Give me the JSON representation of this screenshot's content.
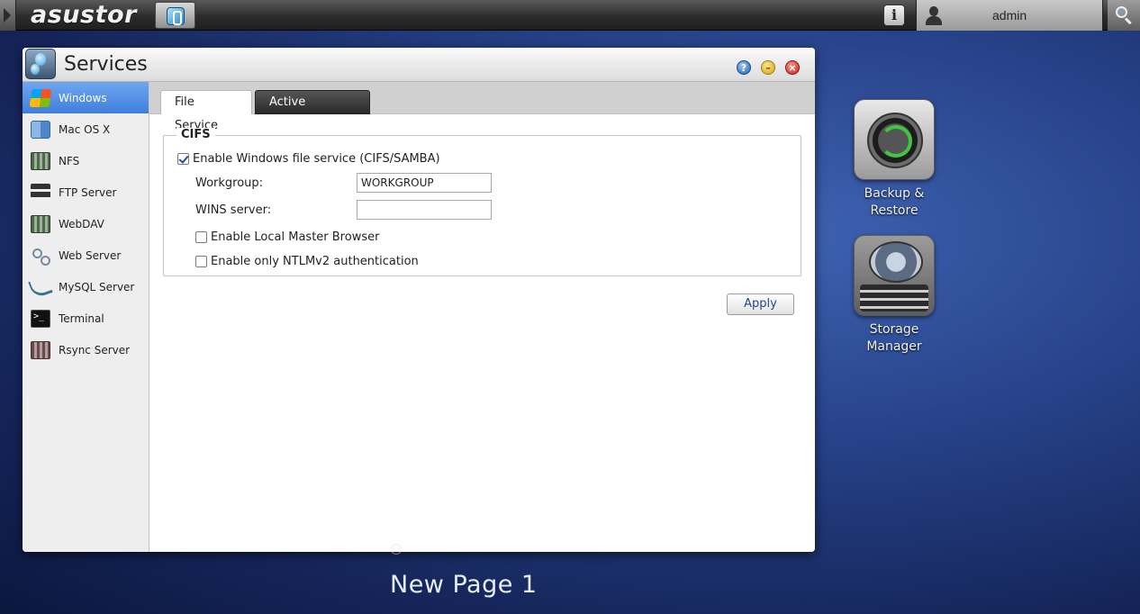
{
  "topbar": {
    "brand": "asustor",
    "username": "admin"
  },
  "window": {
    "title": "Services"
  },
  "sidebar": {
    "items": [
      {
        "label": "Windows",
        "icon": "windows-icon",
        "active": true
      },
      {
        "label": "Mac OS X",
        "icon": "mac-icon",
        "active": false
      },
      {
        "label": "NFS",
        "icon": "nfs-icon",
        "active": false
      },
      {
        "label": "FTP Server",
        "icon": "ftp-icon",
        "active": false
      },
      {
        "label": "WebDAV",
        "icon": "webdav-icon",
        "active": false
      },
      {
        "label": "Web Server",
        "icon": "web-server-icon",
        "active": false
      },
      {
        "label": "MySQL Server",
        "icon": "mysql-icon",
        "active": false
      },
      {
        "label": "Terminal",
        "icon": "terminal-icon",
        "active": false
      },
      {
        "label": "Rsync Server",
        "icon": "rsync-icon",
        "active": false
      }
    ]
  },
  "tabs": [
    {
      "label": "File Service",
      "active": true
    },
    {
      "label": "Active Directory",
      "active": false
    }
  ],
  "cifs": {
    "legend": "CIFS",
    "enable_label": "Enable Windows file service (CIFS/SAMBA)",
    "enable_checked": true,
    "workgroup_label": "Workgroup:",
    "workgroup_value": "WORKGROUP",
    "wins_label": "WINS server:",
    "wins_value": "",
    "local_master_label": "Enable Local Master Browser",
    "local_master_checked": false,
    "ntlm_label": "Enable only NTLMv2 authentication",
    "ntlm_checked": false
  },
  "apply_label": "Apply",
  "desktop": {
    "apps": [
      {
        "label_line1": "Backup &",
        "label_line2": "Restore"
      },
      {
        "label_line1": "Storage",
        "label_line2": "Manager"
      }
    ],
    "page_label": "New Page 1"
  },
  "colors": {
    "sidebar_active": "#4f8fe6",
    "desktop_bg": "#27438a",
    "apply_text": "#1e4690"
  }
}
